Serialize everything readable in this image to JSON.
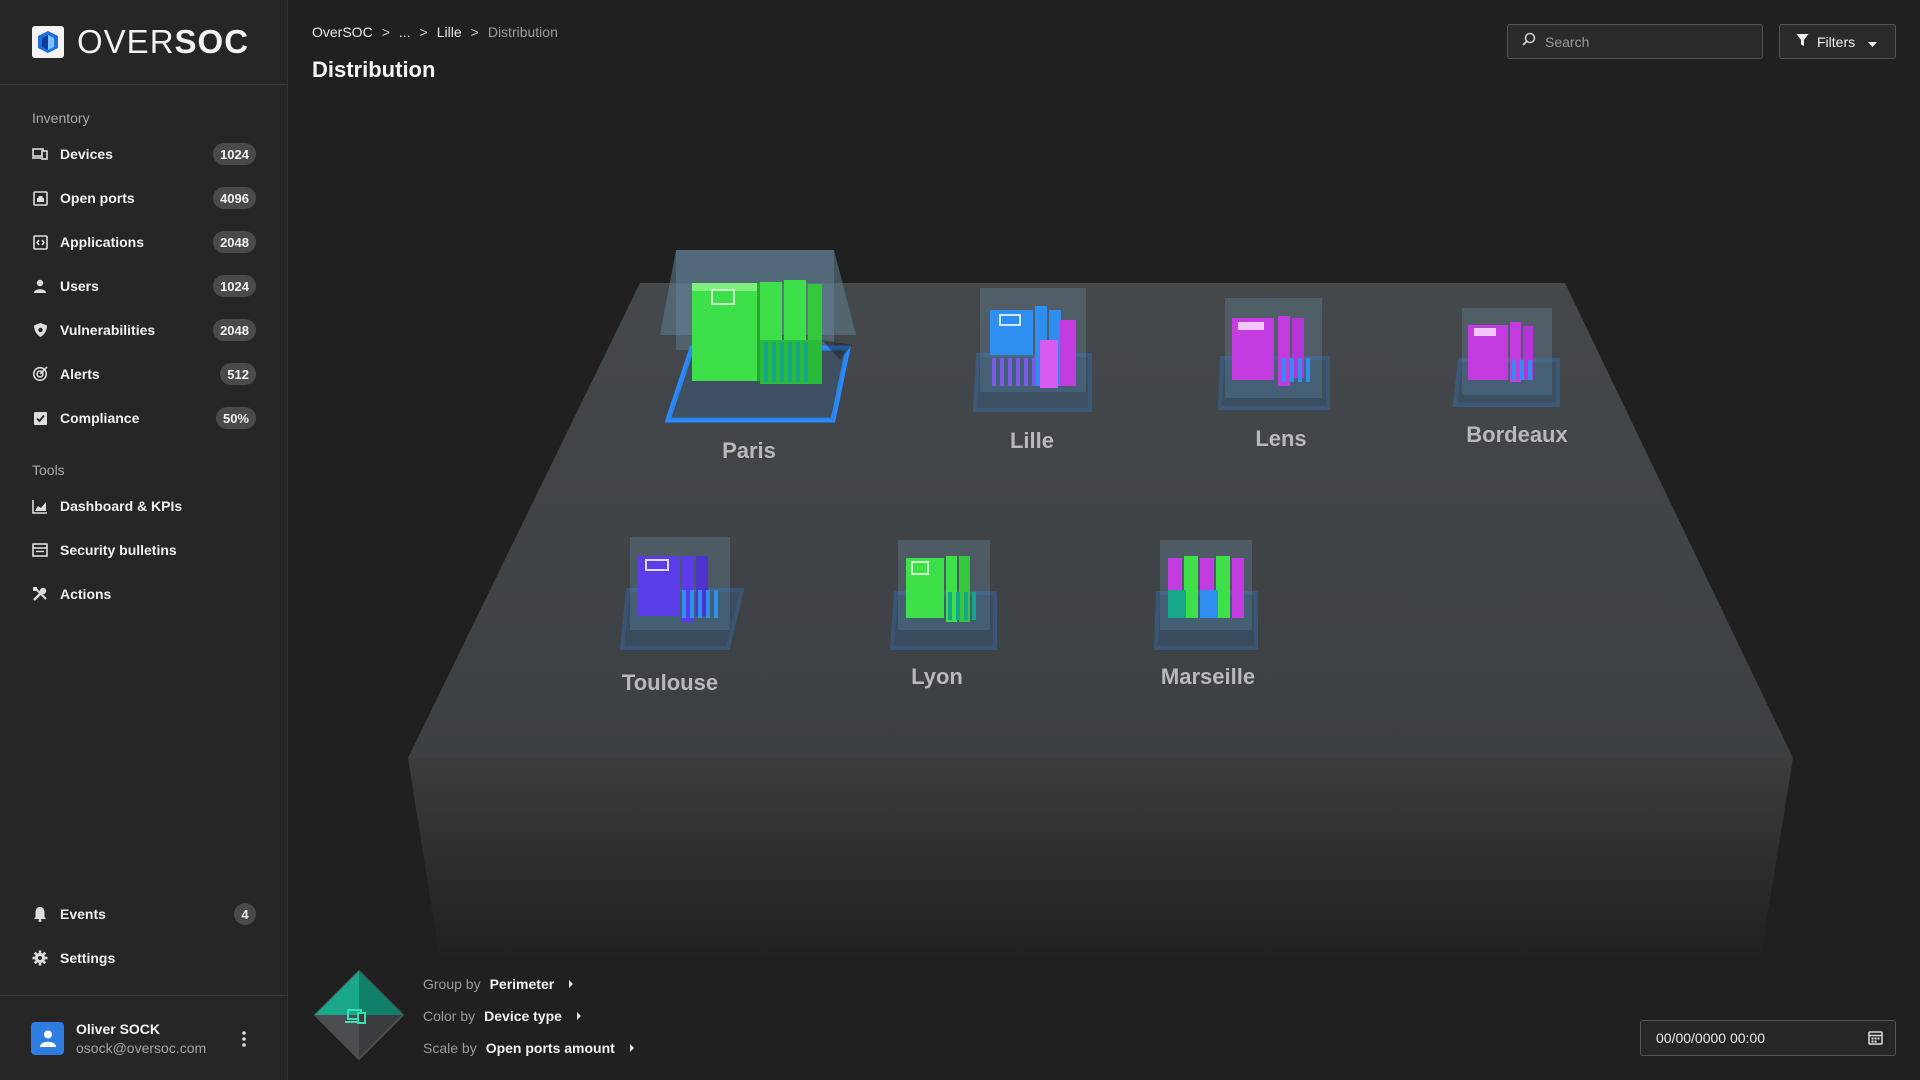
{
  "brand": {
    "name_light": "OVER",
    "name_bold": "SOC"
  },
  "sidebar": {
    "inventory_title": "Inventory",
    "inventory": [
      {
        "label": "Devices",
        "badge": "1024",
        "icon": "devices-icon"
      },
      {
        "label": "Open ports",
        "badge": "4096",
        "icon": "port-icon"
      },
      {
        "label": "Applications",
        "badge": "2048",
        "icon": "code-icon"
      },
      {
        "label": "Users",
        "badge": "1024",
        "icon": "user-icon"
      },
      {
        "label": "Vulnerabilities",
        "badge": "2048",
        "icon": "shield-bug-icon"
      },
      {
        "label": "Alerts",
        "badge": "512",
        "icon": "target-icon"
      },
      {
        "label": "Compliance",
        "badge": "50%",
        "icon": "checklist-icon"
      }
    ],
    "tools_title": "Tools",
    "tools": [
      {
        "label": "Dashboard & KPIs",
        "icon": "chart-icon"
      },
      {
        "label": "Security bulletins",
        "icon": "bulletin-icon"
      },
      {
        "label": "Actions",
        "icon": "tools-icon"
      }
    ],
    "bottom": [
      {
        "label": "Events",
        "badge": "4",
        "icon": "bell-icon"
      },
      {
        "label": "Settings",
        "icon": "gear-icon"
      }
    ],
    "user": {
      "name": "Oliver SOCK",
      "email": "osock@oversoc.com"
    }
  },
  "header": {
    "breadcrumb": [
      "OverSOC",
      "...",
      "Lille",
      "Distribution"
    ],
    "breadcrumb_sep": ">",
    "title": "Distribution",
    "search_placeholder": "Search",
    "filters_label": "Filters"
  },
  "scene": {
    "cities": [
      {
        "name": "Paris",
        "color": "#3ee04a"
      },
      {
        "name": "Lille",
        "color": "#2f8ff0"
      },
      {
        "name": "Lens",
        "color": "#c23ce0"
      },
      {
        "name": "Bordeaux",
        "color": "#c23ce0"
      },
      {
        "name": "Toulouse",
        "color": "#5a3ce8"
      },
      {
        "name": "Lyon",
        "color": "#3ee04a"
      },
      {
        "name": "Marseille",
        "color": "#c23ce0"
      }
    ]
  },
  "controls": {
    "group_by": {
      "key": "Group by",
      "value": "Perimeter"
    },
    "color_by": {
      "key": "Color by",
      "value": "Device type"
    },
    "scale_by": {
      "key": "Scale by",
      "value": "Open ports amount"
    },
    "date_value": "00/00/0000 00:00"
  },
  "colors": {
    "accent": "#2f7de1",
    "platform": "#404346",
    "green": "#3ee04a",
    "blue": "#2f8ff0",
    "purple": "#c23ce0",
    "violet": "#5a3ce8"
  }
}
